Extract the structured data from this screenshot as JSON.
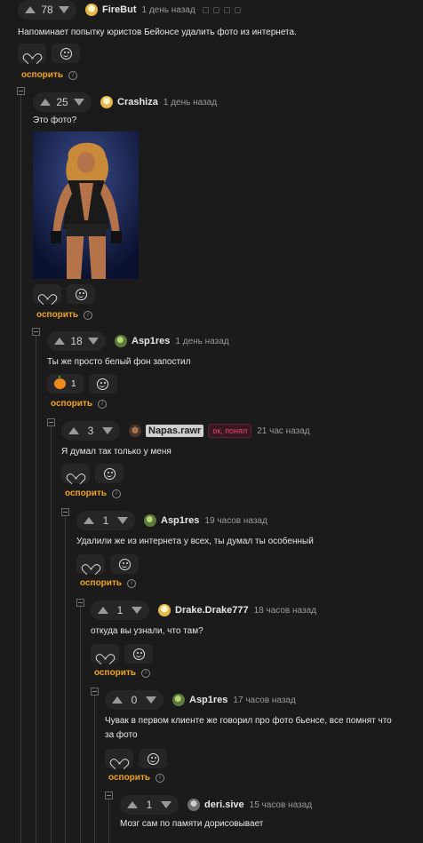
{
  "comments": [
    {
      "score": "78",
      "user": "FireBut",
      "time": "1 день назад",
      "text": "Напоминает попытку юристов Бейонсе удалить фото из интернета.",
      "dispute": "оспорить"
    },
    {
      "score": "25",
      "user": "Crashiza",
      "time": "1 день назад",
      "text": "Это фото?",
      "dispute": "оспорить"
    },
    {
      "score": "18",
      "user": "Asp1res",
      "time": "1 день назад",
      "text": "Ты же просто белый фон запостил",
      "reaction_count": "1",
      "dispute": "оспорить"
    },
    {
      "score": "3",
      "user": "Napas.rawr",
      "tag": "ок, понял",
      "time": "21 час назад",
      "text": "Я думал так только у меня",
      "dispute": "оспорить"
    },
    {
      "score": "1",
      "user": "Asp1res",
      "time": "19 часов назад",
      "text": "Удалили же из интернета у всех, ты думал ты особенный",
      "dispute": "оспорить"
    },
    {
      "score": "1",
      "user": "Drake.Drake777",
      "time": "18 часов назад",
      "text": "откуда вы узнали, что там?",
      "dispute": "оспорить"
    },
    {
      "score": "0",
      "user": "Asp1res",
      "time": "17 часов назад",
      "text": "Чувак в первом клиенте же говорил про фото бьенсе, все помнят что за фото",
      "dispute": "оспорить"
    },
    {
      "score": "1",
      "user": "deri.sive",
      "time": "15 часов назад",
      "text": "Мозг сам по памяти дорисовывает"
    }
  ],
  "icons": {
    "upvote": "triangle-up-icon",
    "downvote": "triangle-down-icon",
    "like": "heart-icon",
    "react": "smile-plus-icon",
    "info": "info-icon",
    "collapse": "collapse-square-icon"
  },
  "colors": {
    "background": "#1b1b1b",
    "dispute": "#f0a41d",
    "tag": "#e04d6a"
  }
}
